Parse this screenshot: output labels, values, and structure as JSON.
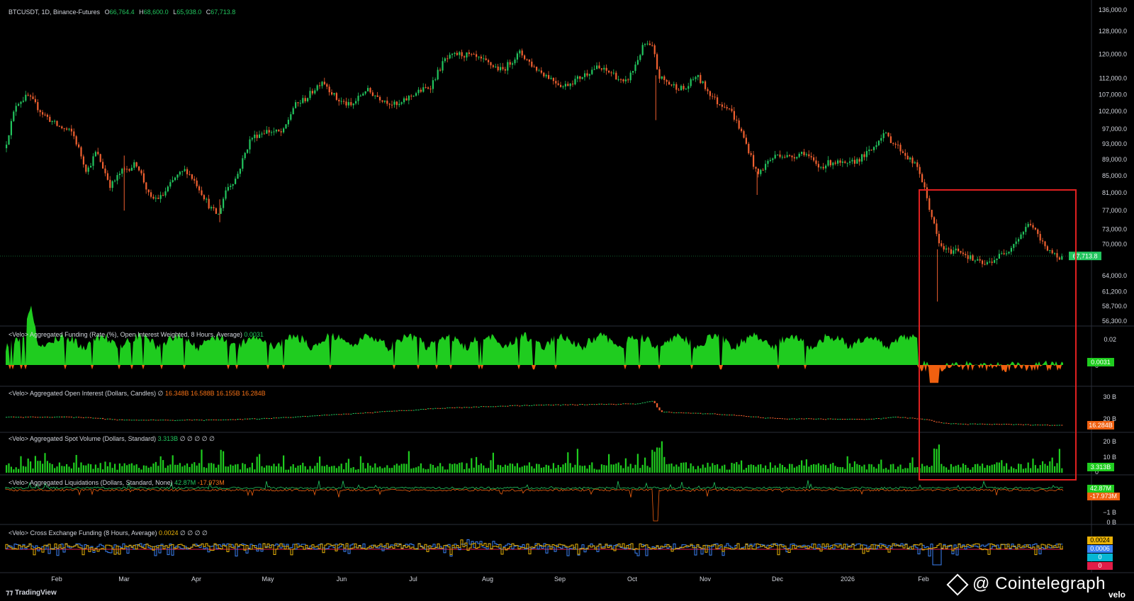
{
  "header": {
    "symbol": "BTCUSDT, 1D, Binance-Futures",
    "o_label": "O",
    "o_val": "66,764.4",
    "h_label": "H",
    "h_val": "68,600.0",
    "l_label": "L",
    "l_val": "65,938.0",
    "c_label": "C",
    "c_val": "67,713.8"
  },
  "panes": {
    "funding": {
      "title": "<Velo> Aggregated Funding (Rate (%), Open Interest Weighted, 8 Hours, Average)",
      "value": "0.0031"
    },
    "oi": {
      "title": "<Velo> Aggregated Open Interest (Dollars, Candles)",
      "vals": [
        "16.348B",
        "16.588B",
        "16.155B",
        "16.284B"
      ]
    },
    "spot": {
      "title": "<Velo> Aggregated Spot Volume (Dollars, Standard)",
      "value": "3.313B",
      "extra": "∅ ∅ ∅ ∅ ∅"
    },
    "liq": {
      "title": "<Velo> Aggregated Liquidations (Dollars, Standard, None)",
      "long": "42.87M",
      "short": "-17.973M"
    },
    "xfund": {
      "title": "<Velo> Cross Exchange Funding (8 Hours, Average)",
      "value": "0.0024",
      "extra": "∅ ∅ ∅ ∅"
    }
  },
  "branding": {
    "platform": "TradingView",
    "source": "velo",
    "watermark": "@ Cointelegraph"
  },
  "chart_data": {
    "type": "candlestick",
    "symbol": "BTCUSDT",
    "interval": "1D",
    "price_axis_ticks": [
      136000,
      128000,
      120000,
      112000,
      107000,
      102000,
      97000,
      93000,
      89000,
      85000,
      81000,
      77000,
      73000,
      70000,
      64000,
      61200,
      58700,
      56300
    ],
    "price_axis_labels": [
      "136,000.0",
      "128,000.0",
      "120,000.0",
      "112,000.0",
      "107,000.0",
      "102,000.0",
      "97,000.0",
      "93,000.0",
      "89,000.0",
      "85,000.0",
      "81,000.0",
      "77,000.0",
      "73,000.0",
      "70,000.0",
      "64,000.0",
      "61,200.0",
      "58,700.0",
      "56,300.0"
    ],
    "last_price": 67713.8,
    "last_price_label": "67,713.8",
    "x_axis_labels": [
      "Feb",
      "Mar",
      "Apr",
      "May",
      "Jun",
      "Jul",
      "Aug",
      "Sep",
      "Oct",
      "Nov",
      "Dec",
      "2026",
      "Feb"
    ],
    "price_path": [
      {
        "t": 0,
        "p": 93500
      },
      {
        "t": 14,
        "p": 104500
      },
      {
        "t": 30,
        "p": 106500
      },
      {
        "t": 50,
        "p": 101500
      },
      {
        "t": 70,
        "p": 98000
      },
      {
        "t": 92,
        "p": 96000
      },
      {
        "t": 112,
        "p": 86000
      },
      {
        "t": 125,
        "p": 91000
      },
      {
        "t": 145,
        "p": 82500
      },
      {
        "t": 160,
        "p": 86000
      },
      {
        "t": 182,
        "p": 88000
      },
      {
        "t": 200,
        "p": 79500
      },
      {
        "t": 216,
        "p": 80000
      },
      {
        "t": 235,
        "p": 84500
      },
      {
        "t": 250,
        "p": 86500
      },
      {
        "t": 265,
        "p": 83000
      },
      {
        "t": 284,
        "p": 77500
      },
      {
        "t": 295,
        "p": 76000
      },
      {
        "t": 306,
        "p": 82000
      },
      {
        "t": 320,
        "p": 84500
      },
      {
        "t": 340,
        "p": 94500
      },
      {
        "t": 360,
        "p": 96500
      },
      {
        "t": 385,
        "p": 96000
      },
      {
        "t": 400,
        "p": 103500
      },
      {
        "t": 418,
        "p": 106000
      },
      {
        "t": 440,
        "p": 111500
      },
      {
        "t": 460,
        "p": 105500
      },
      {
        "t": 480,
        "p": 103500
      },
      {
        "t": 500,
        "p": 108500
      },
      {
        "t": 520,
        "p": 106000
      },
      {
        "t": 545,
        "p": 103500
      },
      {
        "t": 565,
        "p": 107000
      },
      {
        "t": 590,
        "p": 109500
      },
      {
        "t": 610,
        "p": 118000
      },
      {
        "t": 628,
        "p": 120000
      },
      {
        "t": 645,
        "p": 119500
      },
      {
        "t": 665,
        "p": 117500
      },
      {
        "t": 690,
        "p": 114500
      },
      {
        "t": 715,
        "p": 120500
      },
      {
        "t": 735,
        "p": 115500
      },
      {
        "t": 755,
        "p": 112500
      },
      {
        "t": 775,
        "p": 109500
      },
      {
        "t": 800,
        "p": 112500
      },
      {
        "t": 820,
        "p": 115500
      },
      {
        "t": 845,
        "p": 113500
      },
      {
        "t": 860,
        "p": 110000
      },
      {
        "t": 872,
        "p": 114500
      },
      {
        "t": 888,
        "p": 123500
      },
      {
        "t": 900,
        "p": 122000
      },
      {
        "t": 908,
        "p": 112500
      },
      {
        "t": 925,
        "p": 110000
      },
      {
        "t": 945,
        "p": 108500
      },
      {
        "t": 960,
        "p": 113000
      },
      {
        "t": 975,
        "p": 108500
      },
      {
        "t": 990,
        "p": 104500
      },
      {
        "t": 1005,
        "p": 103500
      },
      {
        "t": 1020,
        "p": 97500
      },
      {
        "t": 1035,
        "p": 90500
      },
      {
        "t": 1045,
        "p": 85000
      },
      {
        "t": 1060,
        "p": 88500
      },
      {
        "t": 1075,
        "p": 90500
      },
      {
        "t": 1090,
        "p": 89500
      },
      {
        "t": 1110,
        "p": 91000
      },
      {
        "t": 1130,
        "p": 87000
      },
      {
        "t": 1150,
        "p": 88500
      },
      {
        "t": 1170,
        "p": 87500
      },
      {
        "t": 1190,
        "p": 89500
      },
      {
        "t": 1205,
        "p": 91500
      },
      {
        "t": 1220,
        "p": 96000
      },
      {
        "t": 1240,
        "p": 92500
      },
      {
        "t": 1255,
        "p": 89500
      },
      {
        "t": 1270,
        "p": 86500
      },
      {
        "t": 1285,
        "p": 77500
      },
      {
        "t": 1298,
        "p": 70000
      },
      {
        "t": 1310,
        "p": 68500
      },
      {
        "t": 1325,
        "p": 69000
      },
      {
        "t": 1345,
        "p": 67000
      },
      {
        "t": 1362,
        "p": 66000
      },
      {
        "t": 1380,
        "p": 67500
      },
      {
        "t": 1395,
        "p": 69000
      },
      {
        "t": 1410,
        "p": 71500
      },
      {
        "t": 1425,
        "p": 74500
      },
      {
        "t": 1440,
        "p": 70500
      },
      {
        "t": 1455,
        "p": 68500
      },
      {
        "t": 1465,
        "p": 66500
      },
      {
        "t": 1472,
        "p": 67713.8
      }
    ],
    "funding_axis_labels": [
      "0.02",
      "0"
    ],
    "funding_last": "0.0031",
    "oi_axis_labels": [
      "30 B",
      "20 B"
    ],
    "oi_last": "16.284B",
    "spot_axis_labels": [
      "20 B",
      "10 B",
      "0"
    ],
    "spot_last": "3.313B",
    "liq_axis_labels": [
      "−1 B",
      "0 B"
    ],
    "liq_last_long": "42.87M",
    "liq_last_short": "-17.973M",
    "xfund_last_labels": [
      "0.0024",
      "0.0006",
      "0",
      "0"
    ]
  }
}
